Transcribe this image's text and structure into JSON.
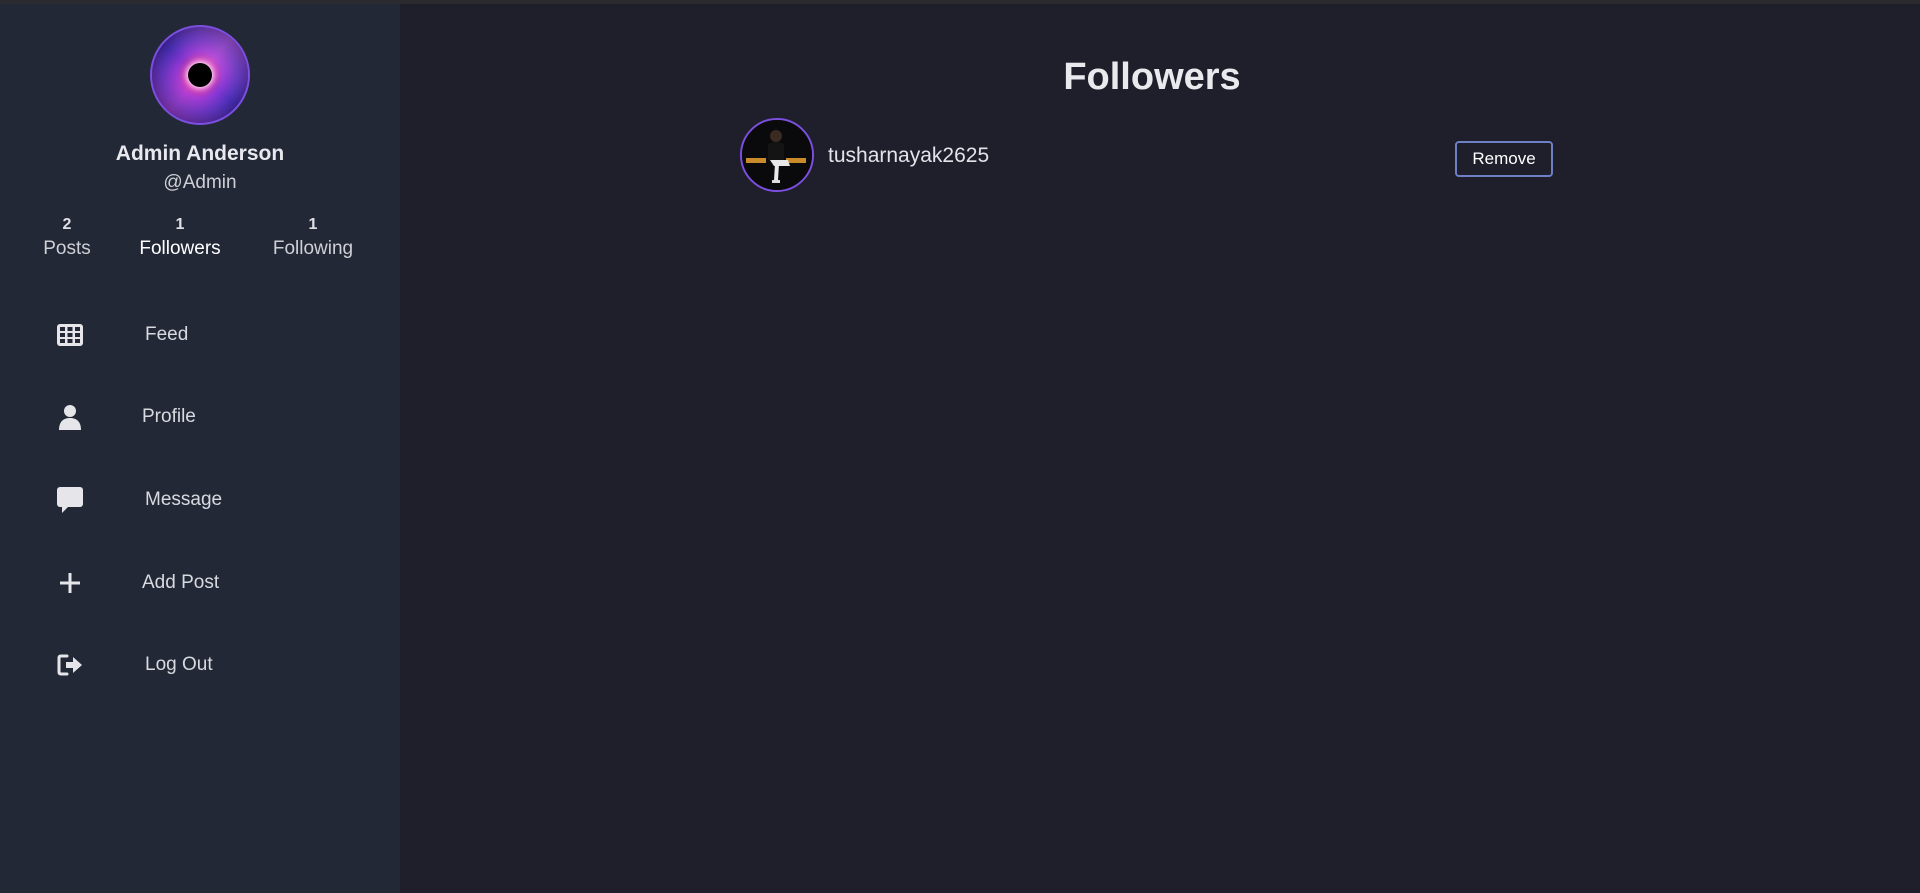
{
  "profile": {
    "name": "Admin Anderson",
    "handle": "@Admin",
    "stats": [
      {
        "count": "2",
        "label": "Posts"
      },
      {
        "count": "1",
        "label": "Followers"
      },
      {
        "count": "1",
        "label": "Following"
      }
    ]
  },
  "nav": [
    {
      "label": "Feed",
      "icon": "grid-icon"
    },
    {
      "label": "Profile",
      "icon": "user-icon"
    },
    {
      "label": "Message",
      "icon": "message-icon"
    },
    {
      "label": "Add Post",
      "icon": "plus-icon"
    },
    {
      "label": "Log Out",
      "icon": "logout-icon"
    }
  ],
  "page": {
    "title": "Followers",
    "followers": [
      {
        "username": "tusharnayak2625",
        "action_label": "Remove"
      }
    ]
  },
  "colors": {
    "background": "#1e1f2a",
    "sidebar": "#222835",
    "avatar_ring": "#7c4fe0",
    "button_border": "#6f7fc6"
  }
}
